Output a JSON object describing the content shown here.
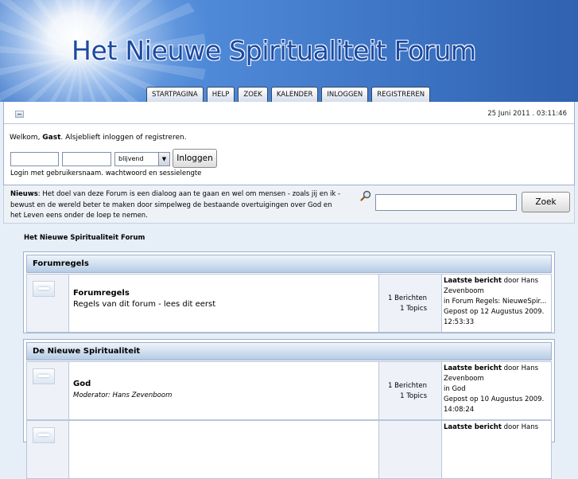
{
  "site": {
    "title": "Het Nieuwe Spiritualiteit Forum",
    "tabs": [
      "STARTPAGINA",
      "HELP",
      "ZOEK",
      "KALENDER",
      "INLOGGEN",
      "REGISTREREN"
    ]
  },
  "userpanel": {
    "datetime": "25 Juni 2011 . 03:11:46",
    "welcome_prefix": "Welkom, ",
    "guest": "Gast",
    "welcome_suffix": ". Alsjeblieft inloggen of registreren.",
    "duration_option": "blijvend",
    "login_button": "Inloggen",
    "login_hint": "Login met gebruikersnaam. wachtwoord en sessielengte"
  },
  "news": {
    "label": "Nieuws",
    "text": ": Het doel van deze Forum is een dialoog aan te gaan en wel om mensen - zoals jij en ik - bewust en de wereld beter te maken door simpelweg de bestaande overtuigingen over God en het Leven eens onder de loep te nemen.",
    "search_button": "Zoek"
  },
  "breadcrumb": "Het Nieuwe Spiritualiteit Forum",
  "categories": [
    {
      "name": "Forumregels",
      "boards": [
        {
          "title": "Forumregels",
          "description": "Regels van dit forum - lees dit eerst",
          "posts": "1 Berichten",
          "topics": "1 Topics",
          "last_label": "Laatste bericht",
          "last_by": " door Hans Zevenboom",
          "last_in": "in Forum Regels: NieuweSpir...",
          "last_date": "Gepost op 12 Augustus 2009. 12:53:33"
        }
      ]
    },
    {
      "name": "De Nieuwe Spiritualiteit",
      "boards": [
        {
          "title": "God",
          "moderator": "Moderator: Hans Zevenboom",
          "posts": "1 Berichten",
          "topics": "1 Topics",
          "last_label": "Laatste bericht",
          "last_by": " door Hans Zevenboom",
          "last_in": "in God",
          "last_date": "Gepost op 10 Augustus 2009. 14:08:24"
        },
        {
          "last_label": "Laatste bericht",
          "last_by": " door Hans"
        }
      ]
    }
  ],
  "colors": {
    "header_blue": "#4f8ad8",
    "title_blue": "#1d4aa0",
    "category_bar": "#b5cbe5"
  }
}
